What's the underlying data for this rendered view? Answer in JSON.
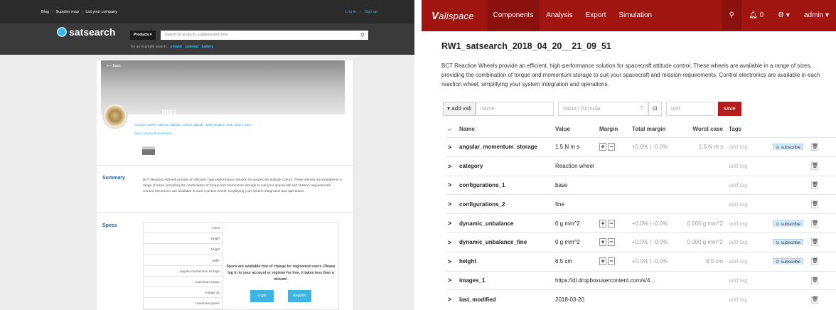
{
  "satsearch": {
    "topbar": {
      "links": [
        "Blog",
        "Supplier map",
        "List your company"
      ],
      "login": "Log in",
      "signup": "Sign up"
    },
    "logo": "satsearch",
    "products_btn": "Products ▾",
    "search_placeholder": "Search for products, suppliers and more",
    "try_label": "Try an example search:",
    "try_examples": [
      "x-band",
      "cubesat",
      "battery"
    ],
    "back": "⟵ Back",
    "product_title": "RW1",
    "tags": "reaction wheel  cubesat  attitude control  attitude determination and control  aocs",
    "manufacturer": "Blue Canyon Technologies",
    "summary_title": "Summary",
    "summary_text": "BCT Reaction Wheels provide an efficient, high-performance solution for spacecraft attitude control. These wheels are available in a range of sizes, providing the combination of torque and momentum storage to suit your spacecraft and mission requirements. Control electronics are available in each reaction wheel, simplifying your system integration and operations.",
    "specs_title": "Specs",
    "spec_labels": [
      "mass",
      "length",
      "height",
      "width",
      "angular momentum storage",
      "maximum torque",
      "voltage dc",
      "maximum power"
    ],
    "specs_message": "Specs are available free of charge for registered users. Please log in to your account or register for free, it takes less than a minute!",
    "login_btn": "Login",
    "register_btn": "Register"
  },
  "valispace": {
    "nav": {
      "logo_initial": "V",
      "logo_rest": "alispace",
      "items": [
        "Components",
        "Analysis",
        "Export",
        "Simulation"
      ],
      "notifications": "0",
      "user": "admin ▾"
    },
    "title": "RW1_satsearch_2018_04_20__21_09_51",
    "description": "BCT Reaction Wheels provide an efficient, high-performance solution for spacecraft attitude control. These wheels are available in a range of sizes, providing the combination of torque and momentum storage to suit your spacecraft and mission requirements. Control electronics are available in each reaction wheel, simplifying your system integration and operations.",
    "toolbar": {
      "add_vali": "▾ add vali",
      "name_placeholder": "name",
      "value_placeholder": "value / formula",
      "unit_placeholder": "unit",
      "save": "save"
    },
    "columns": {
      "expand": "↔",
      "name": "Name",
      "value": "Value",
      "margin": "Margin",
      "total_margin": "Total margin",
      "worst_case": "Worst case",
      "tags": "Tags"
    },
    "add_tag": "add tag",
    "subscribe": "⊙ subscribe",
    "rows": [
      {
        "name": "angular_momentum_storage",
        "value": "1.5 N m s",
        "total_margin": "+0.0% | -0.0%",
        "worst_case": "1.5 N m s"
      },
      {
        "name": "category",
        "value": "Reaction wheel"
      },
      {
        "name": "configurations_1",
        "value": "base"
      },
      {
        "name": "configurations_2",
        "value": "fine"
      },
      {
        "name": "dynamic_unbalance",
        "value": "0 g mm^2",
        "total_margin": "+0.0% | -0.0%",
        "worst_case": "0.000 g mm^2"
      },
      {
        "name": "dynamic_unbalance_fine",
        "value": "0 g mm^2",
        "total_margin": "+0.0% | -0.0%",
        "worst_case": "0.000 g mm^2"
      },
      {
        "name": "height",
        "value": "6.5 cm",
        "total_margin": "+0.0% | -0.0%",
        "worst_case": "6.5 cm"
      },
      {
        "name": "images_1",
        "value": "https://dl.dropboxusercontent.com/s/4..."
      },
      {
        "name": "last_modified",
        "value": "2018-03-20"
      }
    ]
  }
}
